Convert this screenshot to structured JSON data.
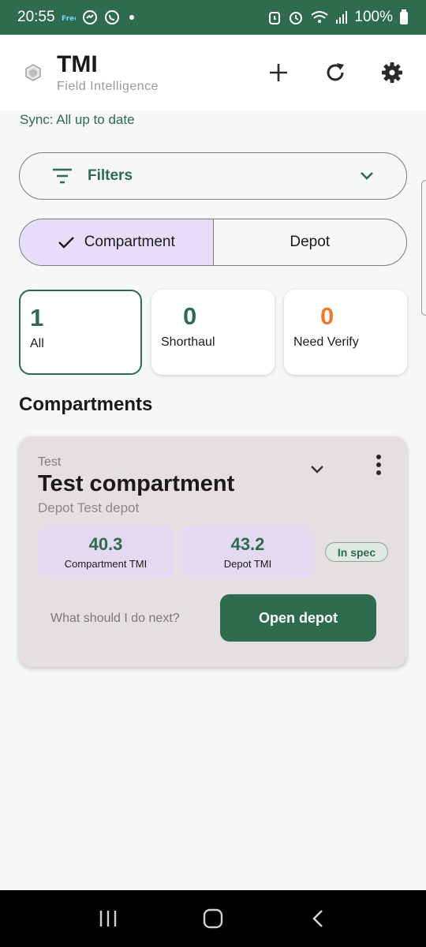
{
  "status_bar": {
    "time": "20:55",
    "battery": "100%",
    "left_icons": [
      "cellular-carrier-icon",
      "messenger-icon",
      "whatsapp-icon",
      "notification-dot-icon"
    ],
    "right_icons": [
      "alarm-clock-icon",
      "alarm-icon",
      "wifi-icon",
      "signal-icon",
      "battery-icon"
    ]
  },
  "app_bar": {
    "title": "TMI",
    "subtitle": "Field Intelligence",
    "actions": [
      "add-icon",
      "refresh-icon",
      "settings-icon"
    ]
  },
  "sync": {
    "text": "Sync: All up to date"
  },
  "filters": {
    "label": "Filters"
  },
  "segmented": {
    "options": [
      {
        "label": "Compartment",
        "selected": true
      },
      {
        "label": "Depot",
        "selected": false
      }
    ]
  },
  "stats": [
    {
      "value": "1",
      "label": "All",
      "selected": true
    },
    {
      "value": "0",
      "label": "Shorthaul",
      "selected": false
    },
    {
      "value": "0",
      "label": "Need Verify",
      "selected": false
    }
  ],
  "section": {
    "title": "Compartments"
  },
  "card": {
    "kicker": "Test",
    "title": "Test compartment",
    "subtitle": "Depot Test depot",
    "metrics": [
      {
        "value": "40.3",
        "label": "Compartment TMI"
      },
      {
        "value": "43.2",
        "label": "Depot TMI"
      }
    ],
    "badge": "In spec",
    "next_link": "What should I do next?",
    "primary_button": "Open depot"
  },
  "colors": {
    "primary": "#2e6b4f",
    "accent_orange": "#ec7a2e",
    "segment_selected": "#e6def8",
    "metric_bg": "#e3d9f1",
    "card_bg": "#e5dfe3"
  },
  "nav_bar": {
    "buttons": [
      "recents-icon",
      "home-icon",
      "back-icon"
    ]
  }
}
